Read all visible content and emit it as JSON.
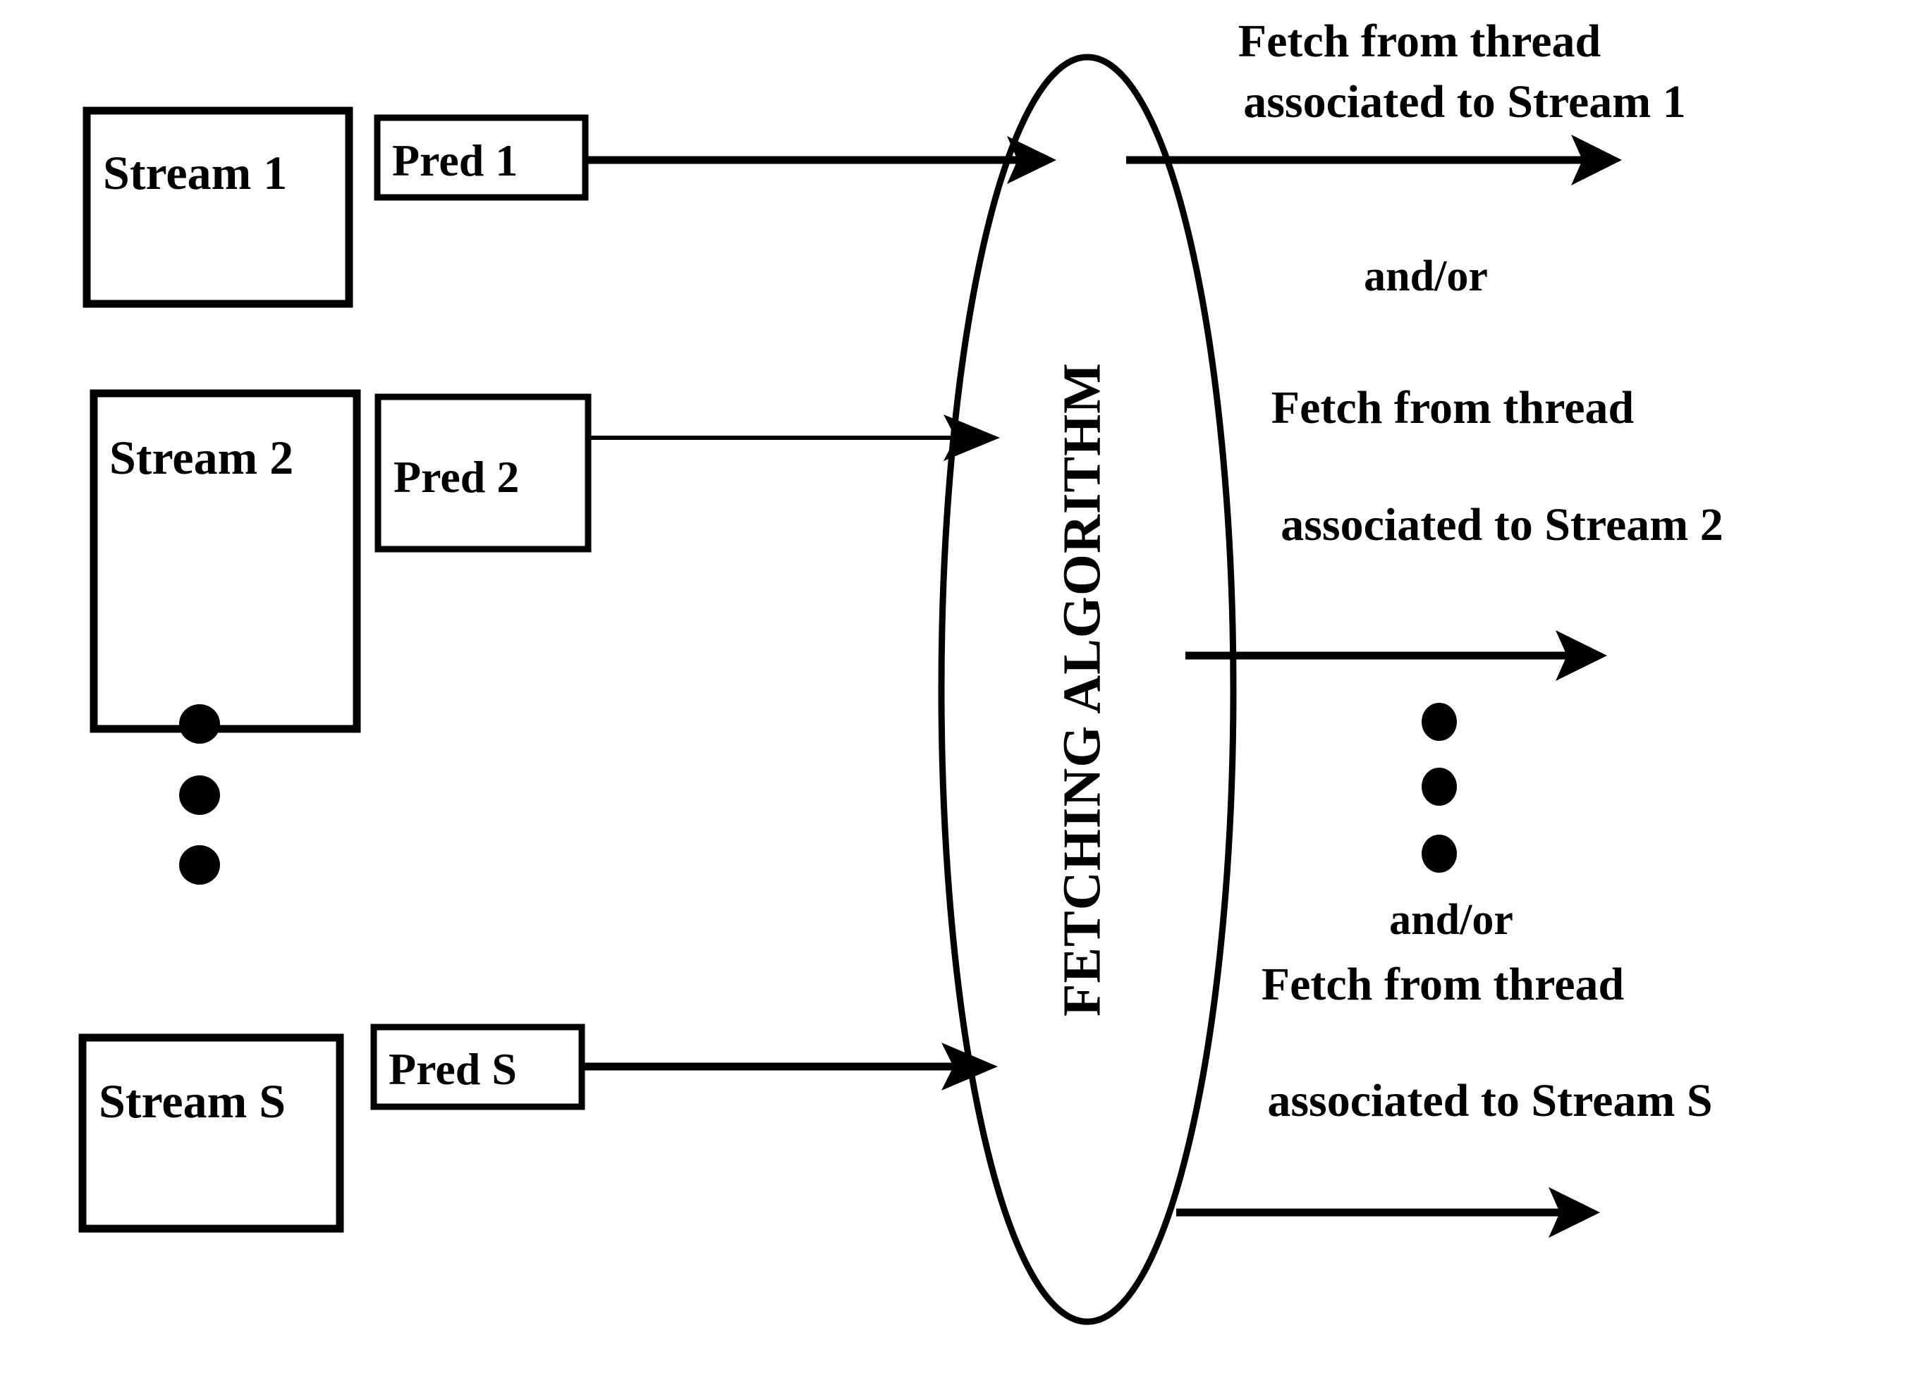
{
  "diagram": {
    "title": "Fetching algorithm stream prediction diagram",
    "center_node": {
      "label": "FETCHING ALGORITHM",
      "shape": "ellipse",
      "orientation": "vertical-bottom-to-top"
    },
    "colors": {
      "stroke": "#000000",
      "fill": "#ffffff",
      "background": "#ffffff"
    },
    "streams": [
      {
        "stream_label": "Stream 1",
        "pred_label": "Pred 1"
      },
      {
        "stream_label": "Stream 2",
        "pred_label": "Pred 2"
      },
      {
        "stream_label": "Stream S",
        "pred_label": "Pred S"
      }
    ],
    "ellipsis_left": [
      "dot",
      "dot",
      "dot"
    ],
    "ellipsis_right": [
      "dot",
      "dot",
      "dot"
    ],
    "outputs": [
      {
        "line1": "Fetch from thread",
        "line2": "associated to Stream 1"
      },
      {
        "line1": "Fetch from thread",
        "line2": "associated to Stream 2"
      },
      {
        "line1": "Fetch from thread",
        "line2": "associated to Stream S"
      }
    ],
    "connectors": [
      {
        "text": "and/or"
      },
      {
        "text": "and/or"
      }
    ]
  }
}
